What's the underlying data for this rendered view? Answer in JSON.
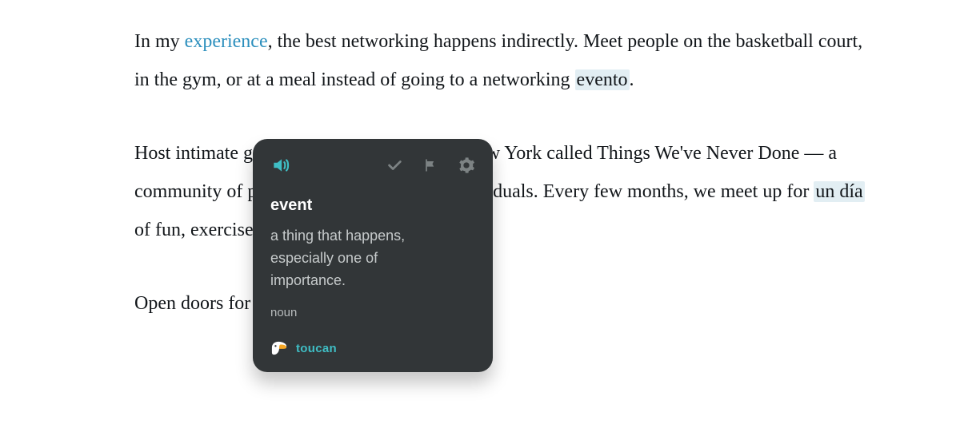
{
  "article": {
    "p1_a": "In my ",
    "p1_link": "experience",
    "p1_b": ", the best networking happens indirectly. Meet people on the basketball court, in the gym, or at a meal instead of going to a networking ",
    "p1_hl": "evento",
    "p1_c": ".",
    "p2_a": "Host intimate gatherings. I host eventos in New York called Things We've Never Done — a community of passionate, hyper-curious individuals. Every few months, we meet up for ",
    "p2_hl": "un día",
    "p2_b": " of fun, exercise and adventure.",
    "p3": "Open doors for people."
  },
  "popup": {
    "word": "event",
    "definition": "a thing that happens, especially one of importance.",
    "pos": "noun",
    "brand": "toucan"
  },
  "colors": {
    "accent": "#3fbec5",
    "icon_muted": "#7d8384"
  }
}
